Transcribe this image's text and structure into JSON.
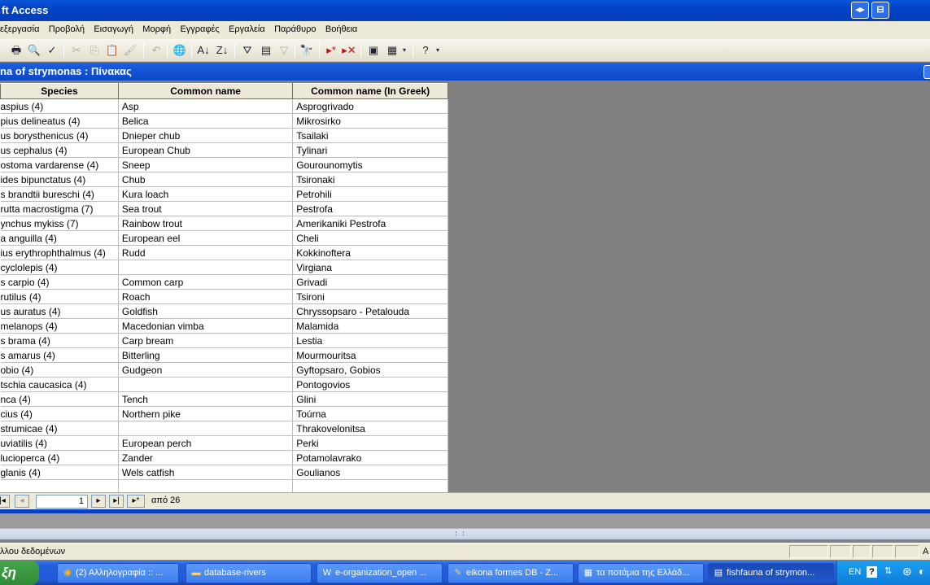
{
  "window": {
    "title": "ft Access"
  },
  "menu": [
    "Επεξεργασία",
    "Προβολή",
    "Εισαγωγή",
    "Μορφή",
    "Εγγραφές",
    "Εργαλεία",
    "Παράθυρο",
    "Βοήθεια"
  ],
  "menu_display": [
    "εξεργασία",
    "Προβολή",
    "Εισαγωγή",
    "Μορφή",
    "Εγγραφές",
    "Εργαλεία",
    "Παράθυρο",
    "Βοήθεια"
  ],
  "doc": {
    "title": "na of strymonas : Πίνακας"
  },
  "table": {
    "columns": [
      "Species",
      "Common name",
      "Common name (In Greek)"
    ],
    "rows": [
      [
        "aspius (4)",
        "Asp",
        "Asprogrivado"
      ],
      [
        "pius delineatus (4)",
        "Belica",
        "Mikrosirko"
      ],
      [
        "us borysthenicus (4)",
        "Dnieper chub",
        "Tsailaki"
      ],
      [
        "us cephalus (4)",
        "European Chub",
        "Tylinari"
      ],
      [
        "ostoma vardarense (4)",
        "Sneep",
        "Gourounomytis"
      ],
      [
        "ides bipunctatus (4)",
        "Chub",
        "Tsironaki"
      ],
      [
        "s brandtii bureschi (4)",
        "Kura loach",
        "Petrohili"
      ],
      [
        "rutta macrostigma (7)",
        "Sea trout",
        "Pestrofa"
      ],
      [
        "ynchus mykiss (7)",
        "Rainbow trout",
        "Amerikaniki Pestrofa"
      ],
      [
        "a anguilla (4)",
        "European eel",
        "Cheli"
      ],
      [
        "ius erythrophthalmus (4)",
        "Rudd",
        "Kokkinoftera"
      ],
      [
        "cyclolepis (4)",
        "",
        "Virgiana"
      ],
      [
        "s carpio (4)",
        "Common carp",
        "Grivadi"
      ],
      [
        "rutilus (4)",
        "Roach",
        "Tsironi"
      ],
      [
        "us auratus (4)",
        "Goldfish",
        "Chryssopsaro - Petalouda"
      ],
      [
        "melanops (4)",
        "Macedonian vimba",
        "Malamida"
      ],
      [
        "s brama (4)",
        "Carp bream",
        "Lestia"
      ],
      [
        "s amarus (4)",
        "Bitterling",
        "Mourmouritsa"
      ],
      [
        "obio (4)",
        "Gudgeon",
        "Gyftopsaro, Gobios"
      ],
      [
        "tschia caucasica (4)",
        "",
        "Pontogovios"
      ],
      [
        "nca (4)",
        "Tench",
        "Glini"
      ],
      [
        "cius (4)",
        "Northern pike",
        "Toúrna"
      ],
      [
        "strumicae (4)",
        "",
        "Thrakovelonitsa"
      ],
      [
        "uviatilis (4)",
        "European perch",
        "Perki"
      ],
      [
        "lucioperca (4)",
        "Zander",
        "Potamolavrako"
      ],
      [
        "glanis (4)",
        "Wels catfish",
        "Goulianos"
      ]
    ]
  },
  "navigator": {
    "record": "1",
    "of_label": "από 26"
  },
  "status": {
    "text": "λλου δεδομένων",
    "right": "A"
  },
  "taskbar": {
    "start": "ξη",
    "tasks": [
      {
        "label": "(2) Αλληλογραφία :: ...",
        "icon": "chrome-icon"
      },
      {
        "label": "database-rivers",
        "icon": "folder-icon"
      },
      {
        "label": "e-organization_open ...",
        "icon": "word-icon"
      },
      {
        "label": "eikona formes DB - Z...",
        "icon": "paint-icon"
      },
      {
        "label": "τα ποτάμια της Ελλάδ...",
        "icon": "powerpoint-icon"
      },
      {
        "label": "fishfauna of strymon...",
        "icon": "access-table-icon"
      }
    ],
    "tray_lang": "EN"
  }
}
